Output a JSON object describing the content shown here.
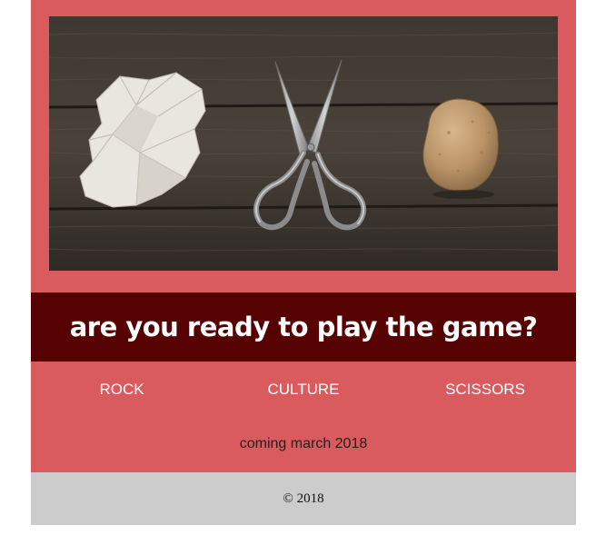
{
  "colors": {
    "page_background": "#d95b5e",
    "banner_background": "#560203",
    "footer_background": "#cccccc",
    "nav_text": "#ffffff"
  },
  "hero": {
    "image": "photo of crumpled paper, scissors and rock on dark wood boards",
    "objects": [
      "crumpled-paper-icon",
      "scissors-icon",
      "rock-icon"
    ]
  },
  "banner": {
    "text": "are you ready to play the game?"
  },
  "nav": {
    "items": [
      {
        "label": "ROCK"
      },
      {
        "label": "CULTURE"
      },
      {
        "label": "SCISSORS"
      }
    ]
  },
  "announcement": {
    "text": "coming march 2018"
  },
  "footer": {
    "text": "© 2018"
  }
}
